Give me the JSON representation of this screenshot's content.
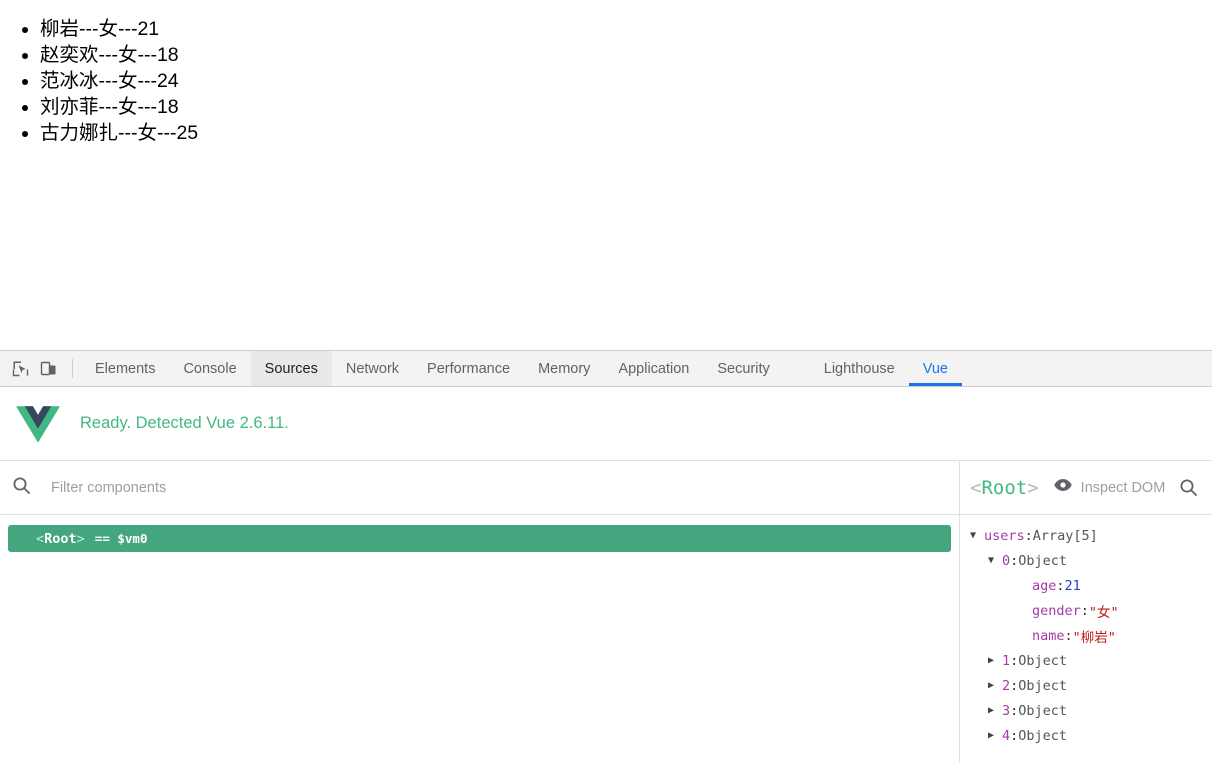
{
  "page": {
    "users_list": [
      "柳岩---女---21",
      "赵奕欢---女---18",
      "范冰冰---女---24",
      "刘亦菲---女---18",
      "古力娜扎---女---25"
    ]
  },
  "devtools": {
    "tabs_main": [
      {
        "label": "Elements",
        "state": "normal"
      },
      {
        "label": "Console",
        "state": "normal"
      },
      {
        "label": "Sources",
        "state": "hovered"
      },
      {
        "label": "Network",
        "state": "normal"
      },
      {
        "label": "Performance",
        "state": "normal"
      },
      {
        "label": "Memory",
        "state": "normal"
      },
      {
        "label": "Application",
        "state": "normal"
      },
      {
        "label": "Security",
        "state": "normal"
      }
    ],
    "tabs_extension": [
      {
        "label": "Lighthouse",
        "state": "normal"
      },
      {
        "label": "Vue",
        "state": "active"
      }
    ],
    "icons": {
      "inspect_cursor": "inspect-element-icon",
      "device_toolbar": "device-toolbar-icon"
    },
    "accent_color": "#1a73e8"
  },
  "vue_panel": {
    "status_text": "Ready. Detected Vue 2.6.11.",
    "status_color": "#42b983",
    "logo": "vue-logo-icon",
    "filter": {
      "placeholder": "Filter components",
      "value": "",
      "icon": "search-icon"
    },
    "components": [
      {
        "angle_open": "<",
        "name": "Root",
        "angle_close": ">",
        "vm": "== $vm0",
        "selected": true,
        "selected_color": "#44a67f"
      }
    ],
    "inspector": {
      "title_angle_open": "<",
      "title_name": "Root",
      "title_angle_close": ">",
      "inspect_dom_label": "Inspect DOM",
      "eye_icon": "eye-icon",
      "search_icon": "search-icon",
      "state_tree": [
        {
          "indent": 1,
          "arrow": "expanded",
          "key": "users",
          "key_kind": "key",
          "value": "Array[5]",
          "value_kind": "type"
        },
        {
          "indent": 2,
          "arrow": "expanded",
          "key": "0",
          "key_kind": "index",
          "value": "Object",
          "value_kind": "type"
        },
        {
          "indent": 3,
          "arrow": "none",
          "key": "age",
          "key_kind": "key",
          "value": "21",
          "value_kind": "num"
        },
        {
          "indent": 3,
          "arrow": "none",
          "key": "gender",
          "key_kind": "key",
          "value": "\"女\"",
          "value_kind": "str"
        },
        {
          "indent": 3,
          "arrow": "none",
          "key": "name",
          "key_kind": "key",
          "value": "\"柳岩\"",
          "value_kind": "str"
        },
        {
          "indent": 2,
          "arrow": "collapsed",
          "key": "1",
          "key_kind": "index",
          "value": "Object",
          "value_kind": "type"
        },
        {
          "indent": 2,
          "arrow": "collapsed",
          "key": "2",
          "key_kind": "index",
          "value": "Object",
          "value_kind": "type"
        },
        {
          "indent": 2,
          "arrow": "collapsed",
          "key": "3",
          "key_kind": "index",
          "value": "Object",
          "value_kind": "type"
        },
        {
          "indent": 2,
          "arrow": "collapsed",
          "key": "4",
          "key_kind": "index",
          "value": "Object",
          "value_kind": "type"
        }
      ]
    }
  }
}
